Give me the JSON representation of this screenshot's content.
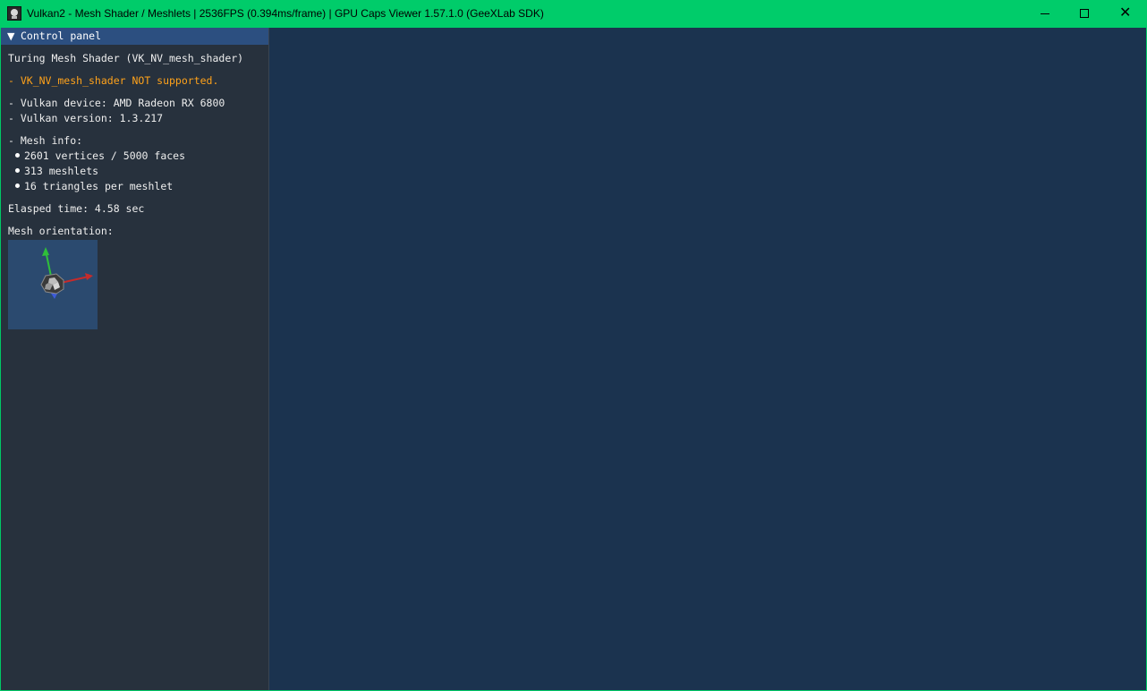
{
  "window": {
    "title": "Vulkan2 - Mesh Shader / Meshlets | 2536FPS (0.394ms/frame) | GPU Caps Viewer 1.57.1.0 (GeeXLab SDK)",
    "close_glyph": "✕"
  },
  "control_panel": {
    "header_arrow": "▼",
    "header_label": "Control panel",
    "heading": "Turing Mesh Shader (VK_NV_mesh_shader)",
    "warning": "- VK_NV_mesh_shader NOT supported.",
    "device": "- Vulkan device: AMD Radeon RX 6800",
    "version": "- Vulkan version: 1.3.217",
    "mesh_info_label": "- Mesh info:",
    "mesh_info": [
      "2601 vertices / 5000 faces",
      "313 meshlets",
      "16 triangles per meshlet"
    ],
    "elapsed": "Elasped time: 4.58 sec",
    "orientation_label": "Mesh orientation:"
  },
  "colors": {
    "titlebar": "#00cc6a",
    "viewport": "#1b334f",
    "panel": "#27313d",
    "panel_header": "#2c4f80",
    "warning_text": "#ffa21a",
    "axis_x": "#c62b2b",
    "axis_y": "#2fbf3a",
    "axis_z": "#3d5bd9"
  },
  "icons": {
    "app": "geexlab-skull-icon",
    "minimize": "minimize-icon",
    "maximize": "maximize-icon",
    "close": "close-icon"
  }
}
